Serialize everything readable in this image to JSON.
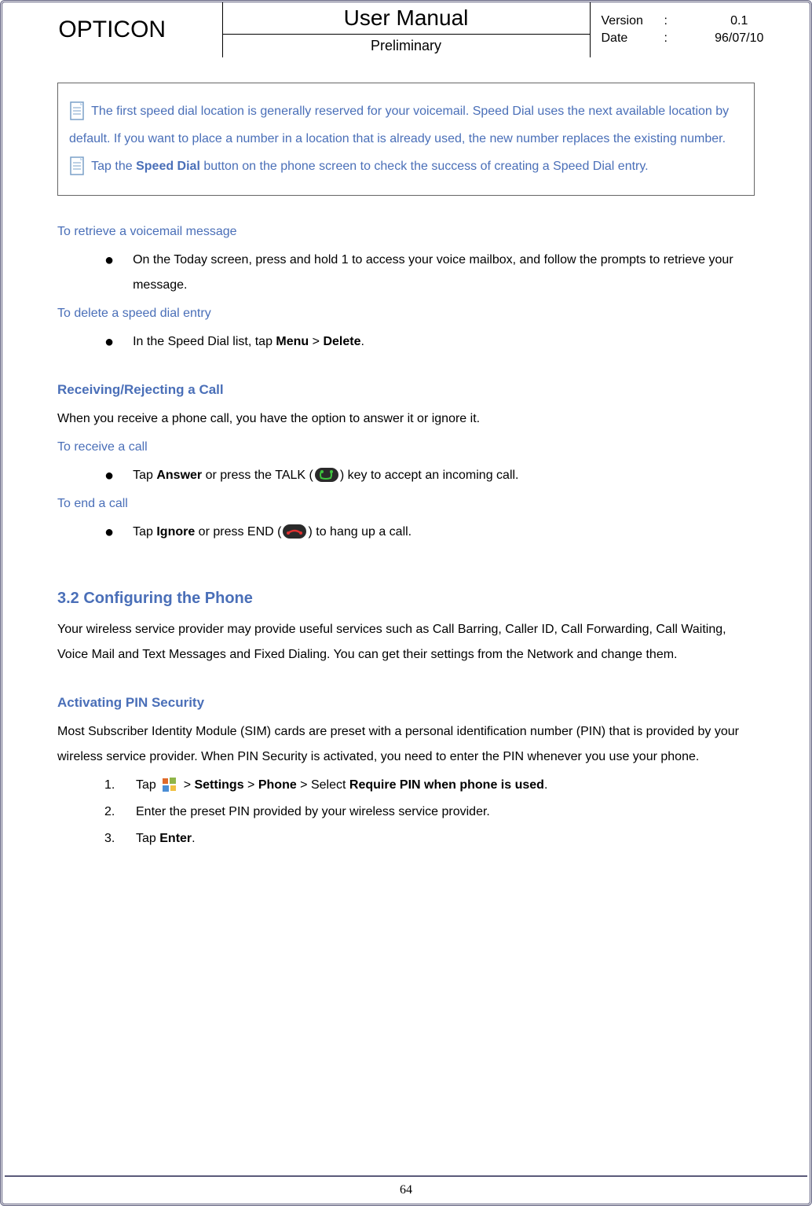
{
  "header": {
    "brand": "OPTICON",
    "title": "User Manual",
    "subtitle": "Preliminary",
    "version_label": "Version",
    "version_sep": ":",
    "version_value": "0.1",
    "date_label": "Date",
    "date_sep": ":",
    "date_value": "96/07/10"
  },
  "notebox": {
    "note1a": "The first speed dial location is generally reserved for your voicemail. Speed Dial uses the next available location by default. If you want to place a number in a location that is already used, the new number replaces the existing number.",
    "note2a": "Tap the ",
    "note2b": "Speed Dial",
    "note2c": " button on the phone screen to check the success of creating a Speed Dial entry."
  },
  "sect1": {
    "h_retrieve": "To retrieve a voicemail message",
    "retrieve_text": "On the Today screen, press and hold 1 to access your voice mailbox, and follow the prompts to retrieve your message.",
    "h_delete": "To delete a speed dial entry",
    "delete_a": "In the Speed Dial list, tap ",
    "delete_b": "Menu",
    "delete_c": " > ",
    "delete_d": "Delete",
    "delete_e": "."
  },
  "sect2": {
    "h_receive_reject": "Receiving/Rejecting a Call",
    "intro": "When you receive a phone call, you have the option to answer it or ignore it.",
    "h_receive": "To receive a call",
    "receive_a": "Tap ",
    "receive_b": "Answer",
    "receive_c": " or press the TALK (",
    "receive_d": ") key to accept an incoming call.",
    "h_end": "To end a call",
    "end_a": "Tap ",
    "end_b": "Ignore",
    "end_c": " or press END (",
    "end_d": ") to hang up a call."
  },
  "sect3": {
    "h_config": "3.2 Configuring the Phone",
    "config_text": "Your wireless service provider may provide useful services such as Call Barring, Caller ID, Call Forwarding, Call Waiting, Voice Mail and Text Messages and Fixed Dialing. You can get their settings from the Network and change them."
  },
  "sect4": {
    "h_pin": "Activating PIN Security",
    "pin_text": "Most Subscriber Identity Module (SIM) cards are preset with a personal identification number (PIN) that is provided by your wireless service provider. When PIN Security is activated, you need to enter the PIN whenever you use your phone.",
    "step1_num": "1.",
    "step1_a": "Tap ",
    "step1_b": " > ",
    "step1_c": "Settings",
    "step1_d": " > ",
    "step1_e": "Phone",
    "step1_f": " > Select ",
    "step1_g": "Require PIN when phone is used",
    "step1_h": ".",
    "step2_num": "2.",
    "step2": "Enter the preset PIN provided by your wireless service provider.",
    "step3_num": "3.",
    "step3_a": "Tap ",
    "step3_b": "Enter",
    "step3_c": "."
  },
  "page_number": "64"
}
